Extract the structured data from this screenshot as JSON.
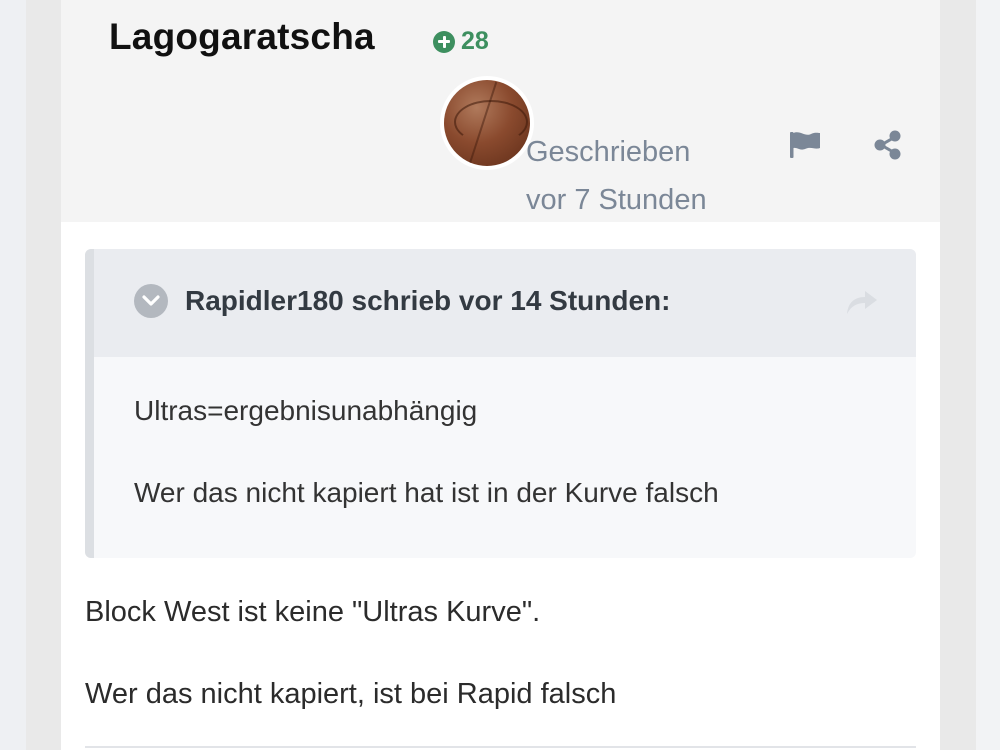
{
  "post": {
    "author": "Lagogaratscha",
    "reputation": "28",
    "posted_label": "Geschrieben",
    "posted_time": "vor 7 Stunden",
    "icons": {
      "reputation": "plus-circle-icon",
      "flag": "flag-icon",
      "share": "share-icon"
    }
  },
  "quote": {
    "citation": "Rapidler180 schrieb vor 14 Stunden:",
    "lines": [
      "Ultras=ergebnisunabhängig",
      "Wer das nicht kapiert hat ist in der Kurve falsch"
    ]
  },
  "body": {
    "lines": [
      "Block West ist keine \"Ultras Kurve\".",
      "Wer das nicht kapiert, ist bei Rapid falsch"
    ]
  },
  "colors": {
    "reputation_green": "#3d8f5f",
    "meta_gray": "#7b8797",
    "header_bg": "#f4f4f4",
    "quote_head_bg": "#eaecf0"
  }
}
